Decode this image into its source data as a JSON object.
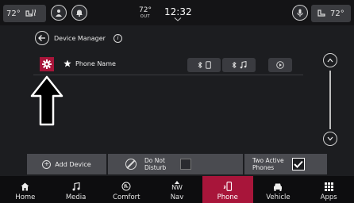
{
  "statusbar": {
    "left_temp": "72°",
    "center_temp": "72°",
    "center_temp_sub": "OUT",
    "clock": "12:32",
    "right_temp": "72°"
  },
  "page": {
    "title": "Device Manager"
  },
  "device": {
    "name": "Phone Name"
  },
  "actions": {
    "add_device": "Add Device",
    "do_not_disturb": [
      "Do Not",
      "Disturb"
    ],
    "two_active_phones": [
      "Two Active",
      "Phones"
    ]
  },
  "nav": [
    {
      "label": "Home",
      "icon": "home-icon"
    },
    {
      "label": "Media",
      "icon": "music-note-icon"
    },
    {
      "label": "Comfort",
      "icon": "seat-climate-icon"
    },
    {
      "label": "Nav",
      "icon": "compass-icon",
      "sub": "NW"
    },
    {
      "label": "Phone",
      "icon": "phone-icon",
      "active": true
    },
    {
      "label": "Vehicle",
      "icon": "car-icon"
    },
    {
      "label": "Apps",
      "icon": "grid-icon"
    }
  ],
  "colors": {
    "accent": "#a8153a",
    "panel": "#4a4b50",
    "background": "#1c1d20"
  }
}
